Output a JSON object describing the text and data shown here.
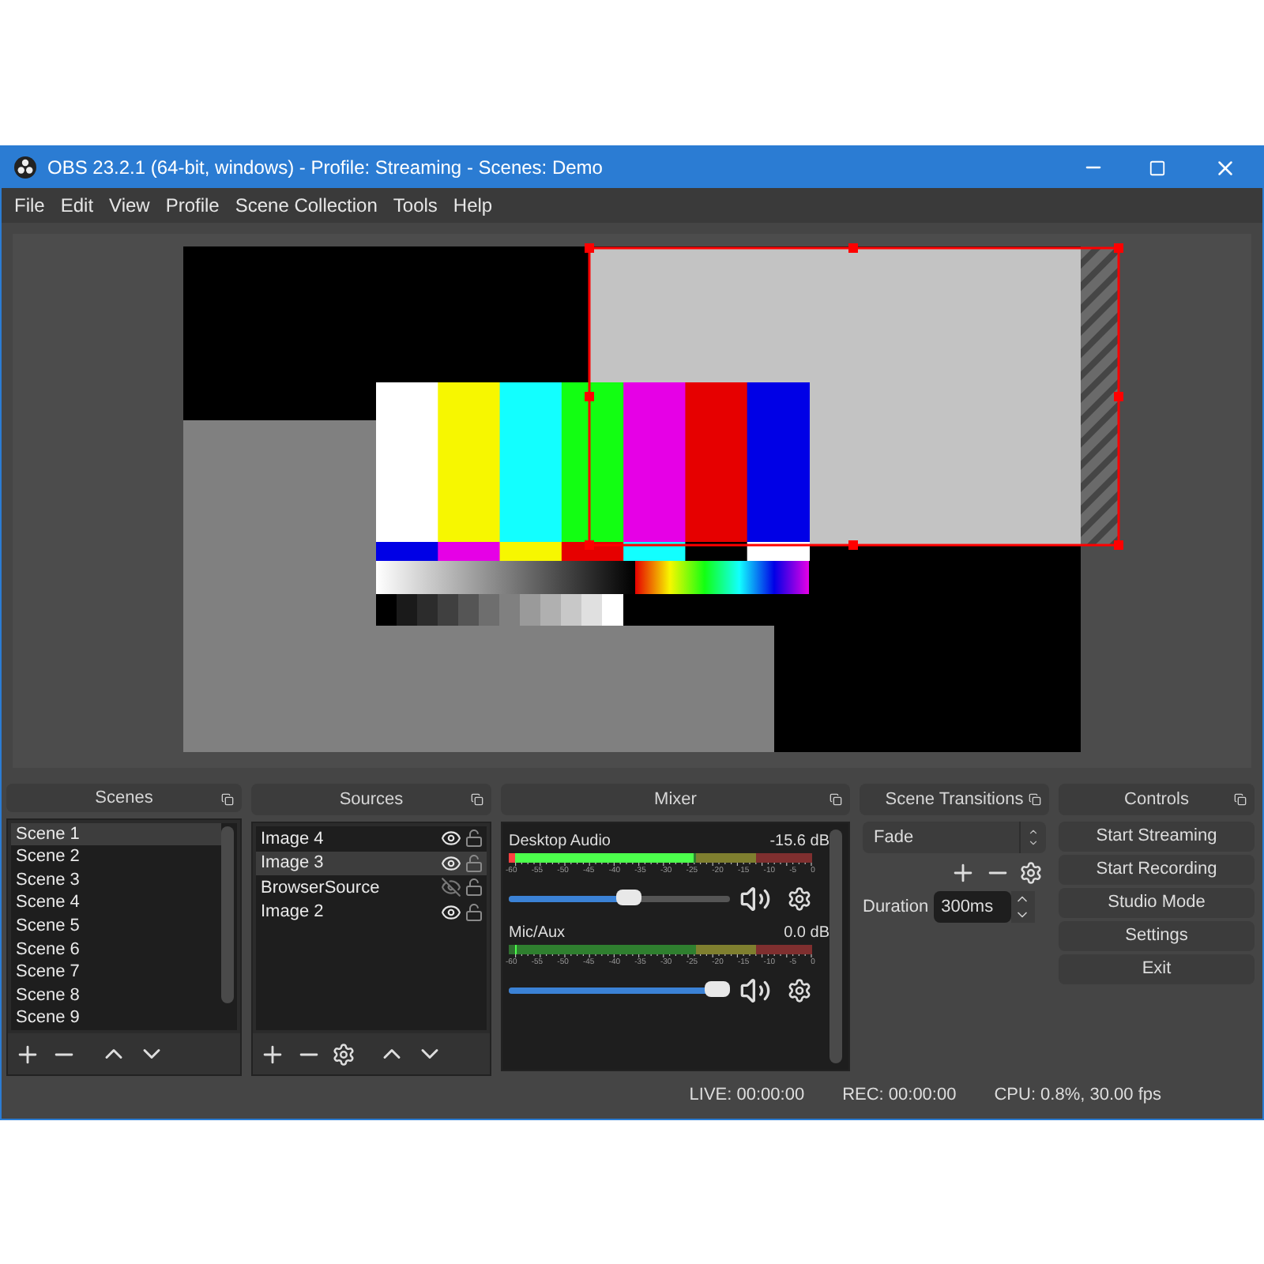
{
  "window": {
    "title": "OBS 23.2.1 (64-bit, windows) - Profile: Streaming - Scenes: Demo"
  },
  "menu": [
    "File",
    "Edit",
    "View",
    "Profile",
    "Scene Collection",
    "Tools",
    "Help"
  ],
  "scenes": {
    "title": "Scenes",
    "items": [
      {
        "label": "Scene 1",
        "selected": true
      },
      {
        "label": "Scene 2",
        "selected": false
      },
      {
        "label": "Scene 3",
        "selected": false
      },
      {
        "label": "Scene 4",
        "selected": false
      },
      {
        "label": "Scene 5",
        "selected": false
      },
      {
        "label": "Scene 6",
        "selected": false
      },
      {
        "label": "Scene 7",
        "selected": false
      },
      {
        "label": "Scene 8",
        "selected": false
      },
      {
        "label": "Scene 9",
        "selected": false
      }
    ]
  },
  "sources": {
    "title": "Sources",
    "items": [
      {
        "label": "Image 4",
        "selected": false,
        "visible": true,
        "locked": false
      },
      {
        "label": "Image 3",
        "selected": true,
        "visible": true,
        "locked": false
      },
      {
        "label": "BrowserSource",
        "selected": false,
        "visible": false,
        "locked": false
      },
      {
        "label": "Image 2",
        "selected": false,
        "visible": true,
        "locked": false
      }
    ]
  },
  "mixer": {
    "title": "Mixer",
    "channels": [
      {
        "name": "Desktop Audio",
        "reading": "-15.6 dB",
        "meter": {
          "level": 0.6
        },
        "volume": {
          "level": 0.55
        },
        "scale": [
          "-60",
          "-55",
          "-50",
          "-45",
          "-40",
          "-35",
          "-30",
          "-25",
          "-20",
          "-15",
          "-10",
          "-5",
          "0"
        ]
      },
      {
        "name": "Mic/Aux",
        "reading": "0.0 dB",
        "meter": {
          "level": 0
        },
        "volume": {
          "level": 1
        },
        "scale": [
          "-60",
          "-55",
          "-50",
          "-45",
          "-40",
          "-35",
          "-30",
          "-25",
          "-20",
          "-15",
          "-10",
          "-5",
          "0"
        ]
      }
    ]
  },
  "transitions": {
    "title": "Scene Transitions",
    "selected": "Fade",
    "duration_label": "Duration",
    "duration": "300ms"
  },
  "controls": {
    "title": "Controls",
    "buttons": [
      "Start Streaming",
      "Start Recording",
      "Studio Mode",
      "Settings",
      "Exit"
    ]
  },
  "status_bar": {
    "live": "LIVE: 00:00:00",
    "rec": "REC: 00:00:00",
    "cpu": "CPU: 0.8%, 30.00 fps"
  }
}
